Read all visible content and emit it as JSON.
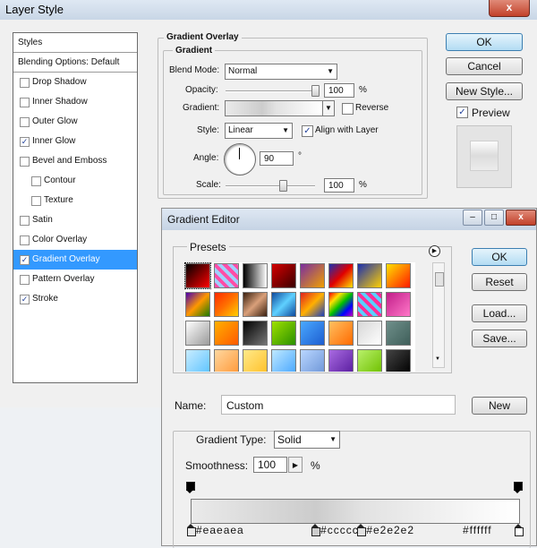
{
  "layer_style": {
    "title": "Layer Style",
    "close_label": "x",
    "styles_items": [
      {
        "label": "Styles",
        "checked": null,
        "header": true
      },
      {
        "label": "Blending Options: Default",
        "checked": null,
        "header": true
      },
      {
        "label": "Drop Shadow",
        "checked": false
      },
      {
        "label": "Inner Shadow",
        "checked": false
      },
      {
        "label": "Outer Glow",
        "checked": false
      },
      {
        "label": "Inner Glow",
        "checked": true
      },
      {
        "label": "Bevel and Emboss",
        "checked": false
      },
      {
        "label": "Contour",
        "checked": false,
        "indent": true
      },
      {
        "label": "Texture",
        "checked": false,
        "indent": true
      },
      {
        "label": "Satin",
        "checked": false
      },
      {
        "label": "Color Overlay",
        "checked": false
      },
      {
        "label": "Gradient Overlay",
        "checked": true,
        "selected": true
      },
      {
        "label": "Pattern Overlay",
        "checked": false
      },
      {
        "label": "Stroke",
        "checked": true
      }
    ],
    "gradient_overlay": {
      "group_title": "Gradient Overlay",
      "subgroup_title": "Gradient",
      "blend_mode_label": "Blend Mode:",
      "blend_mode_value": "Normal",
      "opacity_label": "Opacity:",
      "opacity_value": "100",
      "opacity_fraction": 1.0,
      "percent": "%",
      "gradient_label": "Gradient:",
      "reverse_label": "Reverse",
      "reverse_checked": false,
      "style_label": "Style:",
      "style_value": "Linear",
      "align_label": "Align with Layer",
      "align_checked": true,
      "angle_label": "Angle:",
      "angle_value": "90",
      "degree": "°",
      "scale_label": "Scale:",
      "scale_value": "100",
      "scale_fraction": 0.4
    },
    "buttons": {
      "ok": "OK",
      "cancel": "Cancel",
      "new_style": "New Style...",
      "preview": "Preview",
      "preview_checked": true
    }
  },
  "gradient_editor": {
    "title": "Gradient Editor",
    "presets_label": "Presets",
    "name_label": "Name:",
    "name_value": "Custom",
    "gradient_type_label": "Gradient Type:",
    "gradient_type_value": "Solid",
    "smoothness_label": "Smoothness:",
    "smoothness_value": "100",
    "percent": "%",
    "buttons": {
      "ok": "OK",
      "reset": "Reset",
      "load": "Load...",
      "save": "Save...",
      "new": "New"
    },
    "color_stops": [
      {
        "label": "#eaeaea",
        "color": "#eaeaea",
        "location": 0
      },
      {
        "label": "#cccccc",
        "color": "#cccccc",
        "location": 38
      },
      {
        "label": "#e2e2e2",
        "color": "#e2e2e2",
        "location": 52
      },
      {
        "label": "#ffffff",
        "color": "#ffffff",
        "location": 100
      }
    ],
    "preset_swatches": [
      "linear-gradient(135deg,#000 0%,#ff0000 100%)",
      "repeating-linear-gradient(45deg,#ff4da6 0 4px,#9fd1ff 4px 8px)",
      "linear-gradient(90deg,#000,#fff)",
      "linear-gradient(135deg,#d40000,#3a0000)",
      "linear-gradient(135deg,#7a2ea0,#f0a000)",
      "linear-gradient(135deg,#1a2fb0,#e00000,#ffe100)",
      "linear-gradient(135deg,#1a2fb0,#ffd000)",
      "linear-gradient(135deg,#ffe100,#ff1a00)",
      "linear-gradient(135deg,#4b00b0,#ff9800,#1a7a00)",
      "linear-gradient(135deg,#ff2a00,#ff7000,#ffd000)",
      "linear-gradient(135deg,#3a1f0f,#d9a07a,#3a1f0f)",
      "linear-gradient(135deg,#0e4a9e,#5fd0ff,#0e4a9e)",
      "linear-gradient(135deg,#e02020,#ffb000,#1a3fc0)",
      "linear-gradient(135deg,#ff0000,#ffe000,#00c000,#0000ff,#c000c0)",
      "repeating-linear-gradient(45deg,#ff2d95 0 4px,#5ad0ff 4px 8px)",
      "linear-gradient(135deg,#c21e8a,#ff78c8)",
      "linear-gradient(135deg,#fff,#9a9a9a)",
      "linear-gradient(135deg,#ffb000,#ff5a00)",
      "linear-gradient(135deg,#000,#777)",
      "linear-gradient(135deg,#9fe000,#2a9000)",
      "linear-gradient(135deg,#4aa8ff,#1d5ed0)",
      "linear-gradient(135deg,#ffc060,#ff6a00)",
      "linear-gradient(135deg,#d6d6d6,#ffffff)",
      "linear-gradient(135deg,#6f8f8a,#3f5f5a)",
      "linear-gradient(135deg,#c9ecff,#5ec4ff)",
      "linear-gradient(135deg,#ffd7a0,#ff9a3a)",
      "linear-gradient(135deg,#ffe98a,#ffc12a)",
      "linear-gradient(135deg,#bfe8ff,#4aa8ff)",
      "linear-gradient(135deg,#b9d6ff,#6f97d8)",
      "linear-gradient(135deg,#a86ae0,#5a1ea0)",
      "linear-gradient(135deg,#b8f06a,#6fc000)",
      "linear-gradient(135deg,#444,#000)"
    ]
  }
}
